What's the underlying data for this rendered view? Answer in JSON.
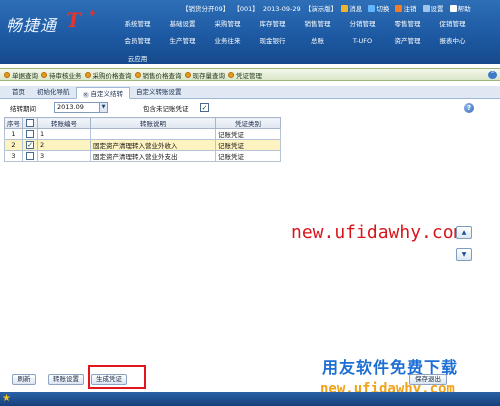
{
  "header": {
    "logo_text": "畅捷通",
    "logo_mark": "T",
    "logo_plus": "+",
    "status_items": [
      "【销货分开09】",
      "【001】",
      "2013-09-29",
      "【演示版】"
    ],
    "actions": [
      {
        "icon": "message-icon",
        "label": "消息",
        "color": "#f0b429"
      },
      {
        "icon": "switch-icon",
        "label": "切换",
        "color": "#5fb8ff"
      },
      {
        "icon": "logout-icon",
        "label": "注销",
        "color": "#f07e2a"
      },
      {
        "icon": "settings-icon",
        "label": "设置",
        "color": "#9fc4ee"
      },
      {
        "icon": "help-icon",
        "label": "帮助",
        "color": "#ffffff"
      }
    ],
    "menu_row1": [
      "系统管理",
      "基础设置",
      "采购管理",
      "库存管理",
      "销售管理",
      "分销管理",
      "零售管理",
      "促销管理"
    ],
    "menu_row2": [
      "会员管理",
      "生产管理",
      "业务往来",
      "现金银行",
      "总账",
      "T-UFO",
      "资产管理",
      "报表中心"
    ],
    "menu_row3": [
      "云应用"
    ]
  },
  "module_tabs": [
    "单据查询",
    "待审核业务",
    "采购价格查询",
    "销售价格查询",
    "现存量查询",
    "凭证管理"
  ],
  "workspace_tabs": [
    {
      "label": "首页",
      "active": false
    },
    {
      "label": "初始化导航",
      "active": false
    },
    {
      "label": "自定义结转",
      "active": true
    },
    {
      "label": "自定义转账设置",
      "active": false
    }
  ],
  "filter": {
    "period_label": "结转期间",
    "period_value": "2013.09",
    "include_label": "包含未记账凭证",
    "include_checked": "✓"
  },
  "grid": {
    "headers": [
      "序号",
      "",
      "转账编号",
      "转账说明",
      "凭证类别"
    ],
    "rows": [
      {
        "seq": "1",
        "checked": "",
        "code": "1",
        "desc": "",
        "voucher": "记账凭证",
        "selected": false
      },
      {
        "seq": "2",
        "checked": "✓",
        "code": "2",
        "desc": "固定资产清理转入营业外收入",
        "voucher": "记账凭证",
        "selected": true
      },
      {
        "seq": "3",
        "checked": "",
        "code": "3",
        "desc": "固定资产清理转入营业外支出",
        "voucher": "记账凭证",
        "selected": false
      }
    ]
  },
  "watermark": {
    "url": "new.ufidawhy.com",
    "cn_text": "用友软件免费下载",
    "url2": "new.ufidawhy.com"
  },
  "side_buttons": {
    "up": "▲",
    "down": "▼"
  },
  "toolbar": {
    "refresh": "刷新",
    "settings": "转账设置",
    "generate": "生成凭证",
    "save_exit": "保存退出"
  },
  "colors": {
    "header_blue": "#1d5aa3",
    "selected_row": "#fdf3c0",
    "highlight_red": "#e0161c",
    "watermark_red": "#d9141b",
    "watermark_blue": "#1d6fd6",
    "watermark_orange": "#f0a21b"
  }
}
